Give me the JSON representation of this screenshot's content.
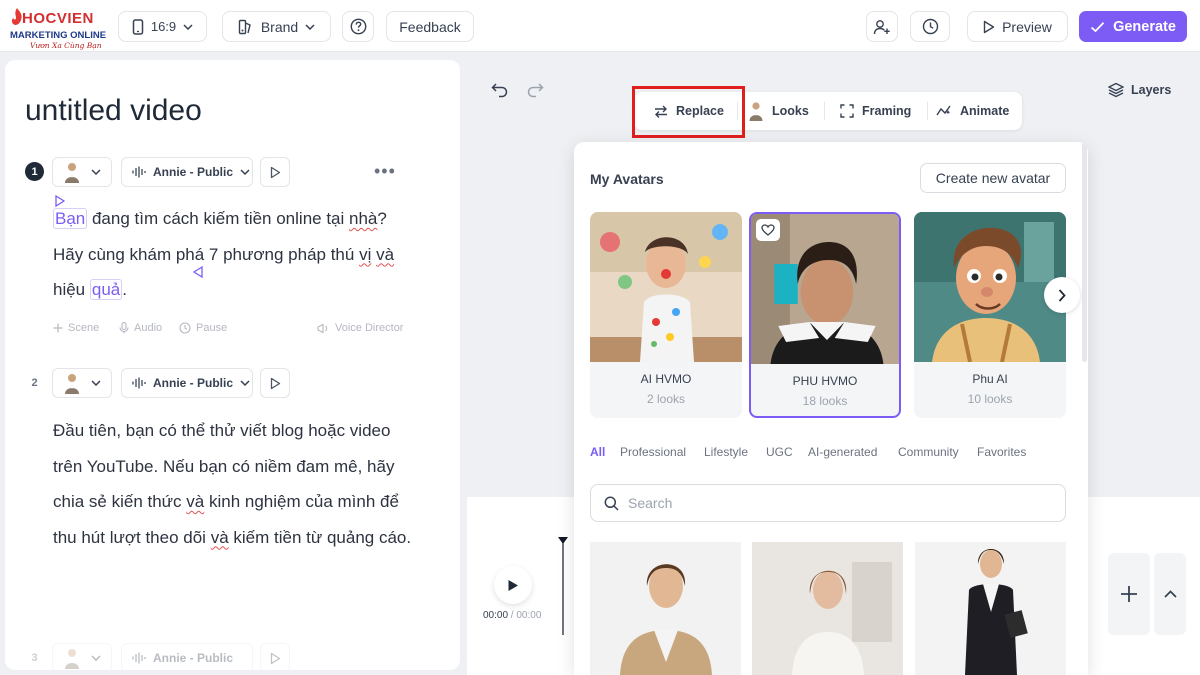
{
  "brand": {
    "logo_main": "HOCVIEN",
    "logo_sub": "MARKETING ONLINE",
    "logo_tagline": "Vươn Xa Cùng Bạn"
  },
  "topbar": {
    "aspect_label": "16:9",
    "brand_label": "Brand",
    "feedback_label": "Feedback",
    "preview_label": "Preview",
    "generate_label": "Generate"
  },
  "editor": {
    "video_title": "untitled video",
    "scenes": [
      {
        "number": "1",
        "voice": "Annie - Public",
        "script_parts": {
          "w1": "Bạn",
          "t1": " đang tìm cách kiếm tiền online tại ",
          "w2": "nhà",
          "t2": "? Hãy cùng khám phá 7 phương pháp thú ",
          "w3": "vị",
          "t3": " ",
          "w4": "và",
          "t4": " hiệu ",
          "w5": "quả",
          "t5": "."
        },
        "tools": {
          "scene": "Scene",
          "audio": "Audio",
          "pause": "Pause",
          "voice_director": "Voice Director"
        }
      },
      {
        "number": "2",
        "voice": "Annie - Public",
        "script_parts": {
          "t1": "Đầu tiên, bạn có thể thử viết blog hoặc video trên YouTube. Nếu bạn có niềm đam mê, hãy chia sẻ kiến thức ",
          "w1": "và",
          "t2": " kinh nghiệm của mình để thu hút lượt theo dõi ",
          "w2": "và",
          "t3": " kiếm tiền từ quảng cáo."
        }
      },
      {
        "number": "3",
        "voice": "Annie - Public"
      }
    ]
  },
  "canvas": {
    "layers_label": "Layers",
    "toolbar": {
      "replace": "Replace",
      "looks": "Looks",
      "framing": "Framing",
      "animate": "Animate"
    },
    "timeline": {
      "current_time": "00:00",
      "separator": " / ",
      "total_time": "00:00"
    }
  },
  "avatar_picker": {
    "title": "My Avatars",
    "create_button": "Create new avatar",
    "avatars": [
      {
        "name": "AI HVMO",
        "looks": "2 looks"
      },
      {
        "name": "PHU HVMO",
        "looks": "18 looks",
        "selected": true
      },
      {
        "name": "Phu AI",
        "looks": "10 looks"
      }
    ],
    "filters": [
      "All",
      "Professional",
      "Lifestyle",
      "UGC",
      "AI-generated",
      "Community",
      "Favorites"
    ],
    "active_filter": "All",
    "search_placeholder": "Search"
  },
  "colors": {
    "accent": "#7c5cf5",
    "highlight_box": "#e01e1e",
    "background": "#eef0f3"
  },
  "icons": [
    "phone-icon",
    "brand-icon",
    "help-icon",
    "add-user-icon",
    "history-icon",
    "play-icon",
    "check-icon",
    "undo-icon",
    "redo-icon",
    "layers-icon",
    "swap-icon",
    "frame-icon",
    "animate-icon",
    "heart-icon",
    "chevron-right-icon",
    "search-icon",
    "plus-icon",
    "chevron-up-icon",
    "waveform-icon",
    "chevron-down-icon"
  ]
}
